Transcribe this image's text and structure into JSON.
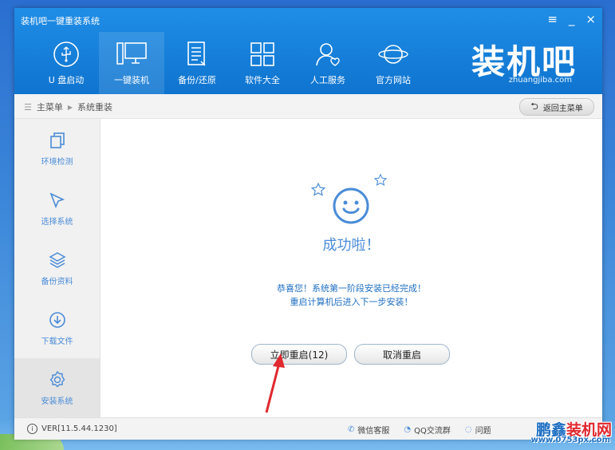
{
  "app": {
    "title": "装机吧一键重装系统",
    "menu_icon": "hamburger-icon",
    "minimize": "_",
    "close": "×"
  },
  "nav": {
    "items": [
      {
        "label": "U 盘启动",
        "icon": "usb-icon"
      },
      {
        "label": "一键装机",
        "icon": "desktop-icon"
      },
      {
        "label": "备份/还原",
        "icon": "document-icon"
      },
      {
        "label": "软件大全",
        "icon": "grid-icon"
      },
      {
        "label": "人工服务",
        "icon": "person-icon"
      },
      {
        "label": "官方网站",
        "icon": "planet-icon"
      }
    ],
    "active_index": 1
  },
  "logo": {
    "text": "装机吧",
    "url": "zhuangjiba.com"
  },
  "breadcrumb": {
    "root": "主菜单",
    "current": "系统重装"
  },
  "back_button": {
    "label": "返回主菜单"
  },
  "steps": [
    {
      "label": "环境检测",
      "icon": "copy-icon"
    },
    {
      "label": "选择系统",
      "icon": "cursor-icon"
    },
    {
      "label": "备份资料",
      "icon": "layers-icon"
    },
    {
      "label": "下载文件",
      "icon": "download-icon"
    },
    {
      "label": "安装系统",
      "icon": "gear-icon"
    }
  ],
  "content": {
    "success_title": "成功啦！",
    "message_line1": "恭喜您！系统第一阶段安装已经完成！",
    "message_line2": "重启计算机后进入下一步安装！",
    "restart_button": "立即重启(12)",
    "cancel_button": "取消重启"
  },
  "statusbar": {
    "version": "VER[11.5.44.1230]",
    "wechat": "微信客服",
    "qq": "QQ交流群",
    "question": "问题"
  },
  "watermark": {
    "brand_a": "鹏鑫",
    "brand_b": "装机网",
    "url": "www.0753px.com"
  },
  "colors": {
    "header": "#0f74cf",
    "accent": "#4a8cd8",
    "arrow": "#e0282e"
  }
}
